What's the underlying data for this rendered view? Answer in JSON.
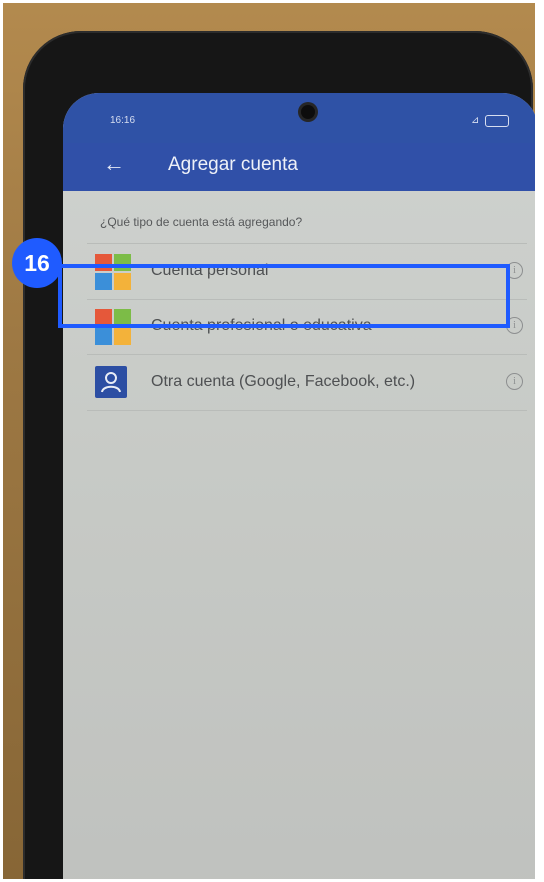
{
  "status_bar": {
    "time": "16:16",
    "signal": "⊿"
  },
  "app_bar": {
    "back_icon": "←",
    "title": "Agregar cuenta"
  },
  "prompt": "¿Qué tipo de cuenta está agregando?",
  "accounts": [
    {
      "label": "Cuenta personal",
      "icon": "microsoft-logo-icon"
    },
    {
      "label": "Cuenta profesional o educativa",
      "icon": "microsoft-logo-icon"
    },
    {
      "label": "Otra cuenta (Google, Facebook, etc.)",
      "icon": "person-icon"
    }
  ],
  "info_glyph": "i",
  "annotation": {
    "step": "16",
    "highlight_color": "#1f5bff"
  },
  "colors": {
    "app_bar": "#3050a8",
    "ms_red": "#e5583a",
    "ms_green": "#7cbc47",
    "ms_blue": "#3b8fd9",
    "ms_yellow": "#f3b23a"
  }
}
